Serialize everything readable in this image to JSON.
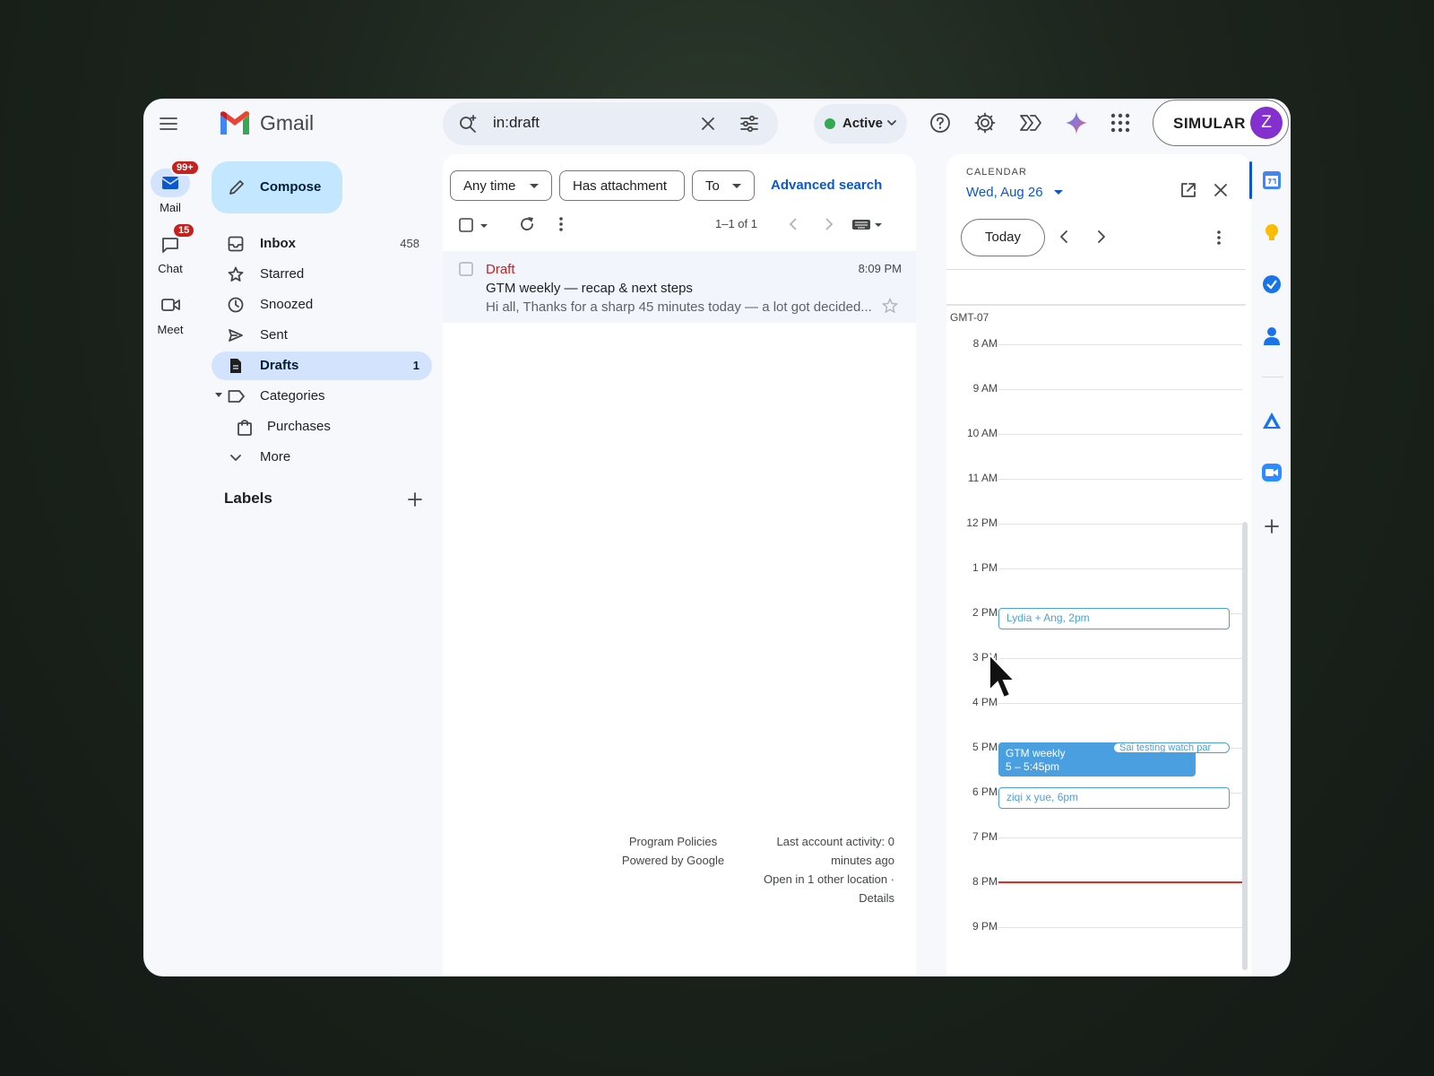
{
  "app": {
    "name": "Gmail"
  },
  "search": {
    "query": "in:draft"
  },
  "status": {
    "label": "Active"
  },
  "account": {
    "brand": "SIMULAR",
    "avatar_initial": "Z"
  },
  "rail": [
    {
      "label": "Mail",
      "badge": "99+"
    },
    {
      "label": "Chat",
      "badge": "15"
    },
    {
      "label": "Meet"
    }
  ],
  "compose": {
    "label": "Compose"
  },
  "nav": [
    {
      "label": "Inbox",
      "count": "458"
    },
    {
      "label": "Starred"
    },
    {
      "label": "Snoozed"
    },
    {
      "label": "Sent"
    },
    {
      "label": "Drafts",
      "count": "1"
    },
    {
      "label": "Categories"
    },
    {
      "label": "Purchases"
    },
    {
      "label": "More"
    }
  ],
  "labels_header": "Labels",
  "filters": {
    "any_time": "Any time",
    "has_attachment": "Has attachment",
    "to": "To",
    "advanced": "Advanced search"
  },
  "toolbar": {
    "pagination": "1–1 of 1"
  },
  "emails": [
    {
      "status": "Draft",
      "time": "8:09 PM",
      "subject": "GTM weekly — recap & next steps",
      "snippet": "Hi all, Thanks for a sharp 45 minutes today — a lot got decided..."
    }
  ],
  "footer": {
    "policies": "Program Policies",
    "powered": "Powered by Google",
    "activity_1": "Last account activity: 0",
    "activity_2": "minutes ago",
    "activity_3": "Open in 1 other location ·",
    "details": "Details"
  },
  "calendar": {
    "header": "CALENDAR",
    "date": "Wed, Aug 26",
    "today": "Today",
    "timezone": "GMT-07",
    "hours": [
      "8 AM",
      "9 AM",
      "10 AM",
      "11 AM",
      "12 PM",
      "1 PM",
      "2 PM",
      "3 PM",
      "4 PM",
      "5 PM",
      "6 PM",
      "7 PM",
      "8 PM",
      "9 PM"
    ],
    "events": [
      {
        "title": "Lydia + Ang, 2pm"
      },
      {
        "title": "GTM weekly",
        "time": "5 – 5:45pm"
      },
      {
        "title": "Sai testing watch par"
      },
      {
        "title": "ziqi x yue, 6pm"
      }
    ]
  },
  "colors": {
    "accent": "#0b57d0",
    "draft_red": "#c5221f",
    "event_blue": "#4a9fe0",
    "now_line": "#d93025"
  }
}
